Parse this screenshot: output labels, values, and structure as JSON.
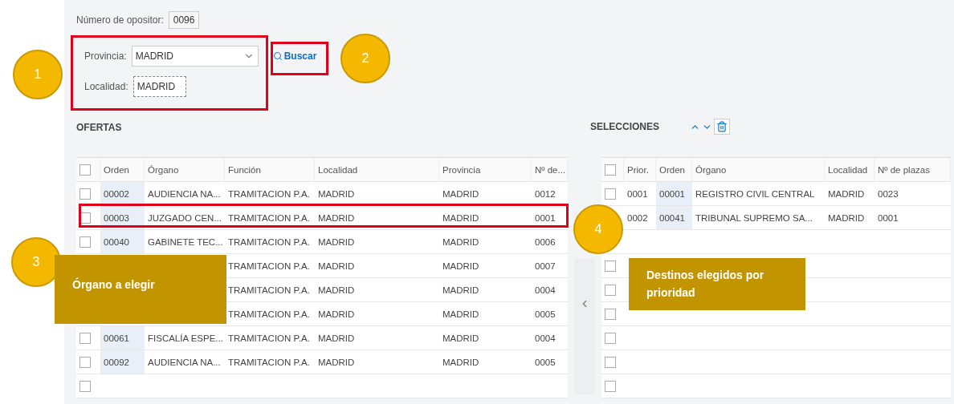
{
  "opositor": {
    "label": "Número de opositor:",
    "value": "0096"
  },
  "provincia": {
    "label": "Provincia:",
    "value": "MADRID"
  },
  "localidad": {
    "label": "Localidad:",
    "value": "MADRID",
    "focused": true
  },
  "search_button": "Buscar",
  "ofertas": {
    "title": "OFERTAS",
    "all_checked": false,
    "columns": [
      "Orden",
      "Órgano",
      "Función",
      "Localidad",
      "Provincia",
      "Nº de..."
    ],
    "rows": [
      {
        "checked": false,
        "cells": [
          "00002",
          "AUDIENCIA NA...",
          "TRAMITACION P.A.",
          "MADRID",
          "MADRID",
          "0012"
        ]
      },
      {
        "checked": false,
        "cells": [
          "00003",
          "JUZGADO CEN...",
          "TRAMITACION P.A.",
          "MADRID",
          "MADRID",
          "0001"
        ]
      },
      {
        "checked": false,
        "cells": [
          "00040",
          "GABINETE TEC...",
          "TRAMITACION P.A.",
          "MADRID",
          "MADRID",
          "0006"
        ]
      },
      {
        "cells": [
          null,
          null,
          "TRAMITACION P.A.",
          "MADRID",
          "MADRID",
          "0007"
        ]
      },
      {
        "cells": [
          null,
          null,
          "TRAMITACION P.A.",
          "MADRID",
          "MADRID",
          "0004"
        ]
      },
      {
        "cells": [
          null,
          null,
          "TRAMITACION P.A.",
          "MADRID",
          "MADRID",
          "0005"
        ]
      },
      {
        "checked": false,
        "cells": [
          "00061",
          "FISCALÍA ESPE...",
          "TRAMITACION P.A.",
          "MADRID",
          "MADRID",
          "0004"
        ]
      },
      {
        "checked": false,
        "cells": [
          "00092",
          "AUDIENCIA NA...",
          "TRAMITACION P.A.",
          "MADRID",
          "MADRID",
          "0005"
        ]
      },
      {
        "checked": false
      }
    ]
  },
  "selecciones": {
    "title": "SELECCIONES",
    "all_checked": false,
    "columns": [
      "Prior.",
      "Orden",
      "Órgano",
      "Localidad",
      "Nº de plazas"
    ],
    "rows": [
      {
        "checked": false,
        "cells": [
          "0001",
          "00001",
          "REGISTRO CIVIL CENTRAL",
          "MADRID",
          "0023"
        ]
      },
      {
        "cells": [
          "0002",
          "00041",
          "TRIBUNAL SUPREMO SA...",
          "MADRID",
          "0001"
        ]
      },
      {},
      {
        "checked": false
      },
      {
        "checked": false
      },
      {
        "checked": false
      },
      {
        "checked": false
      },
      {
        "checked": false
      },
      {
        "checked": false
      }
    ]
  },
  "annotations": {
    "steps": [
      "1",
      "2",
      "3",
      "4"
    ],
    "callouts": [
      "Órgano a elegir",
      "Destinos elegidos por prioridad"
    ]
  }
}
